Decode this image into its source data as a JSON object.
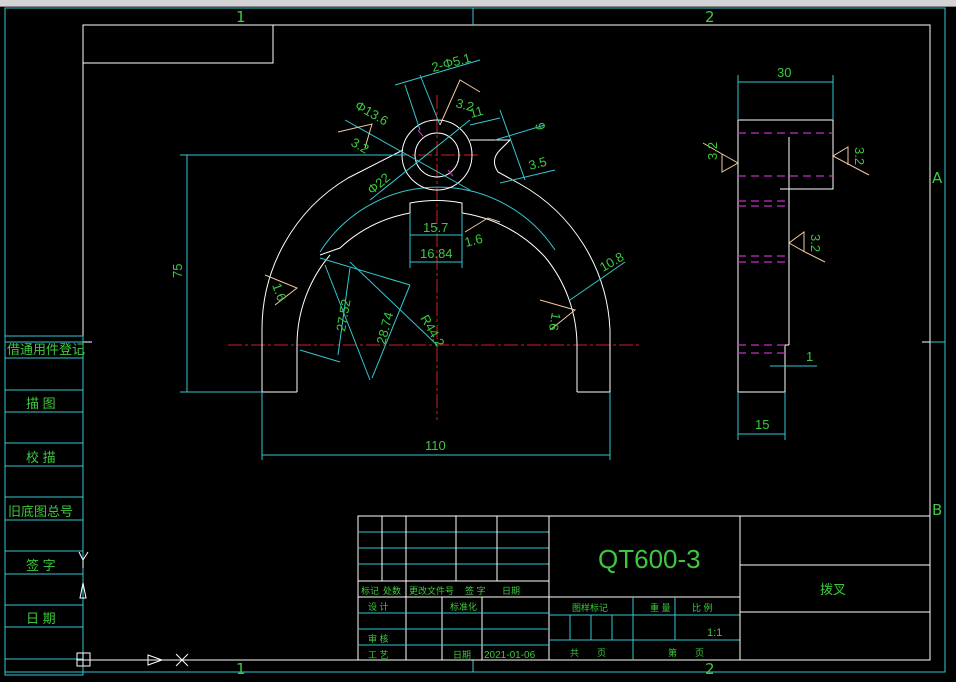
{
  "zones": {
    "top": [
      "1",
      "2"
    ],
    "bottom": [
      "1",
      "2"
    ],
    "right": [
      "A",
      "B"
    ]
  },
  "colors": {
    "background": "#000000",
    "geometry": "#ffffff",
    "dimension": "#35c6d0",
    "text": "#3ec83e",
    "centerline": "#d02020",
    "hidden": "#c030c0",
    "roughness": "#f0c8a0"
  },
  "front_view": {
    "dims": {
      "d_hole": "2-Φ5.1",
      "d_inner": "Φ13.6",
      "d_outer": "Φ22",
      "d11": "11",
      "d9": "9",
      "d35": "3.5",
      "w157": "15.7",
      "w1684": "16.84",
      "h75": "75",
      "w110": "110",
      "r442": "R44.2",
      "l2752": "27.52",
      "l2874": "28.74",
      "t108": "10.8"
    },
    "roughness": {
      "r1": "3.2",
      "r2": "3.2",
      "r3": "1.6",
      "r4": "1.6",
      "r5": "1.6"
    }
  },
  "side_view": {
    "dims": {
      "w30": "30",
      "w15": "15",
      "w1": "1"
    },
    "roughness": {
      "r1": "3.2",
      "r2": "3.2",
      "r3": "3.2"
    }
  },
  "left_strip": [
    "借通用件登记",
    "描 图",
    "校 描",
    "旧底图总号",
    "签 字",
    "日 期"
  ],
  "title_block": {
    "material": "QT600-3",
    "part_name": "拨叉",
    "rev_headers": [
      "标记",
      "处数",
      "更改文件号",
      "签 字",
      "日期"
    ],
    "design": "设 计",
    "standardize": "标准化",
    "review": "审 核",
    "process": "工 艺",
    "date_label": "日期",
    "date": "2021-01-06",
    "drawing_mark": "图样标记",
    "weight": "重 量",
    "scale_label": "比 例",
    "scale": "1:1",
    "total_sheets": "共　　页",
    "sheet_no": "第　　页"
  }
}
